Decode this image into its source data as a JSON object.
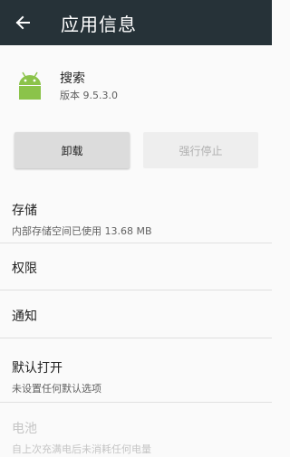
{
  "appbar": {
    "title": "应用信息",
    "back_icon": "arrow-left-icon"
  },
  "app": {
    "name": "搜索",
    "version": "版本 9.5.3.0",
    "icon": "android-robot-icon",
    "icon_color": "#8bc34a"
  },
  "buttons": {
    "uninstall": "卸载",
    "force_stop": "强行停止"
  },
  "items": [
    {
      "title": "存储",
      "subtitle": "内部存储空间已使用 13.68 MB"
    },
    {
      "title": "权限",
      "subtitle": ""
    },
    {
      "title": "通知",
      "subtitle": ""
    },
    {
      "title": "默认打开",
      "subtitle": "未设置任何默认选项"
    },
    {
      "title": "电池",
      "subtitle": "自上次充满电后未消耗任何电量"
    }
  ],
  "colors": {
    "appbar": "#263238",
    "background": "#fafafa"
  }
}
